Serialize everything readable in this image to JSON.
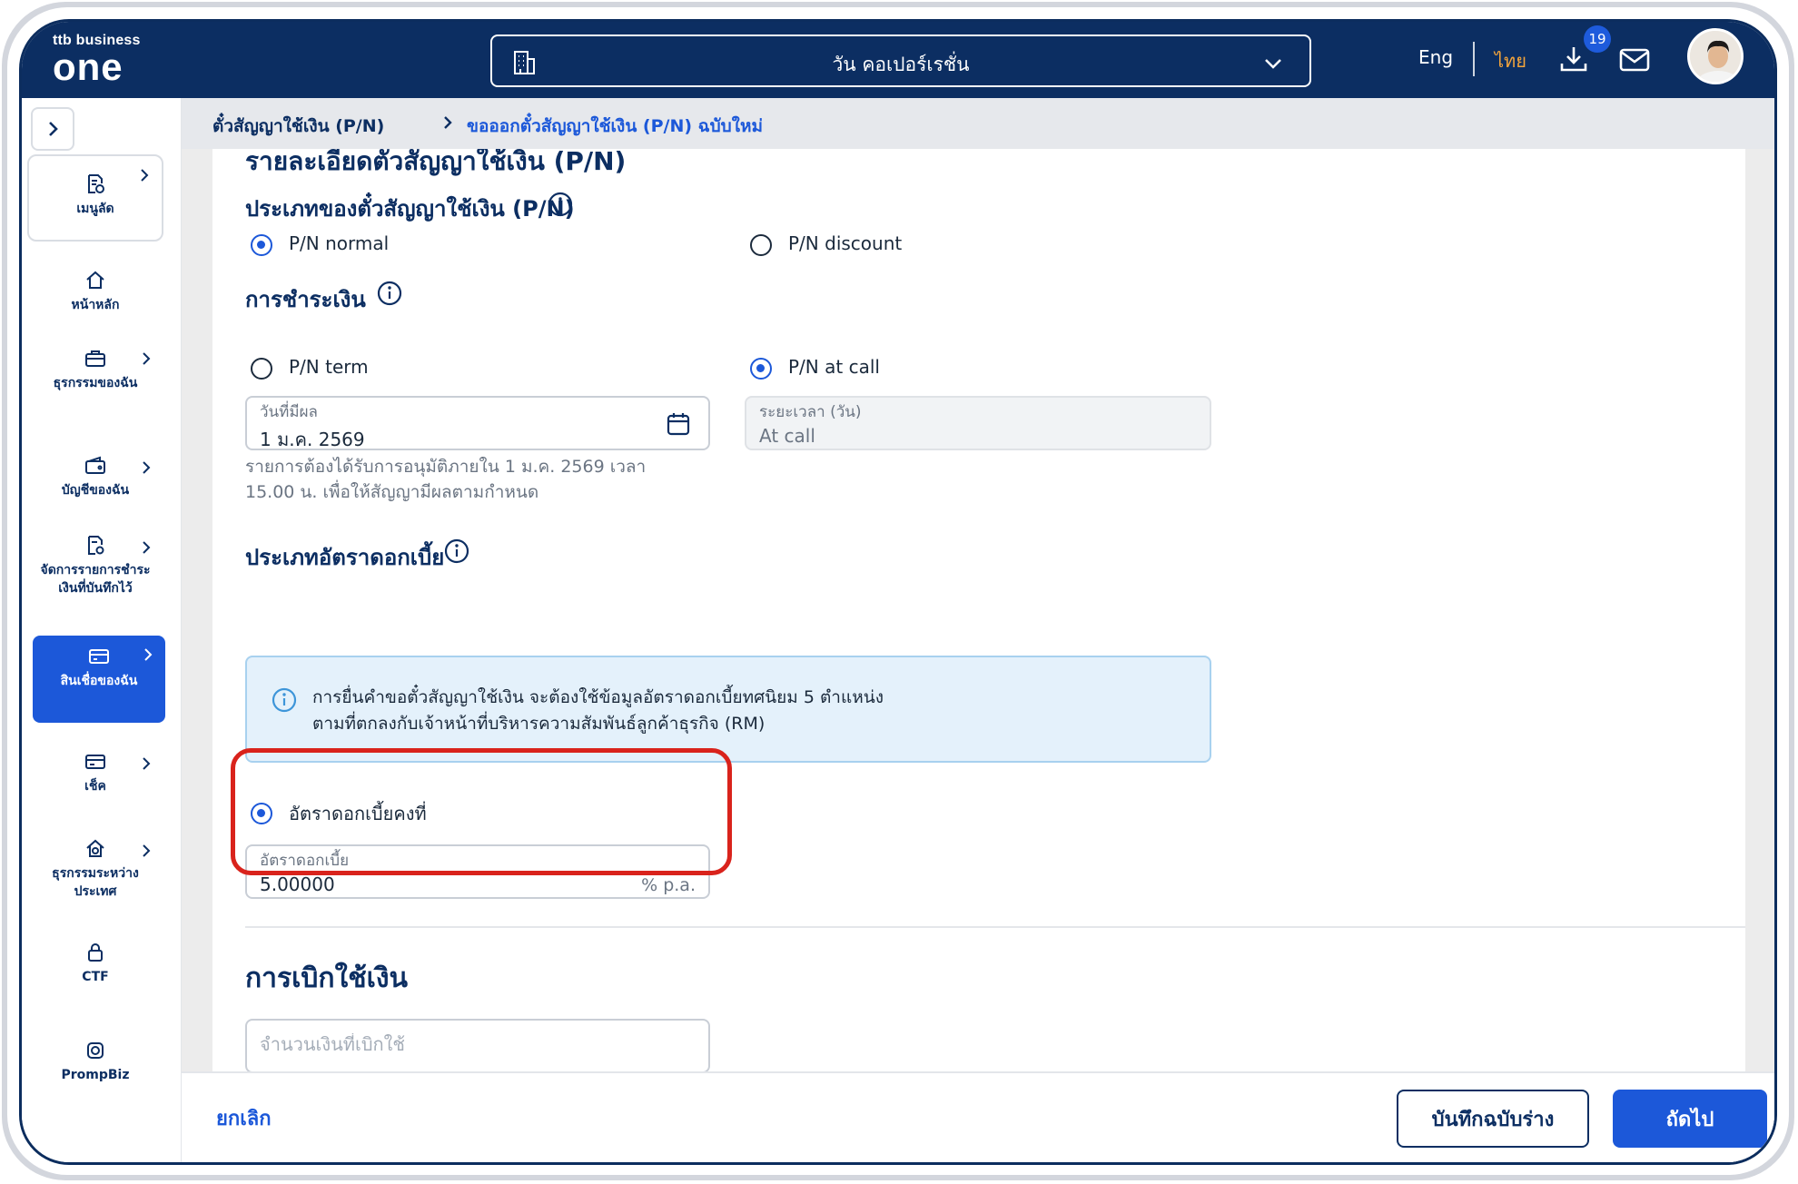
{
  "header": {
    "logo_small": "ttb business",
    "logo_big": "one",
    "company_name": "วัน คอเปอร์เรชั่น",
    "lang_eng": "Eng",
    "lang_th": "ไทย",
    "download_badge": "19"
  },
  "sidebar": {
    "items": [
      {
        "label": "เมนูลัด",
        "icon": "shortcut-doc-icon"
      },
      {
        "label": "หน้าหลัก",
        "icon": "home-icon"
      },
      {
        "label": "ธุรกรรมของฉัน",
        "icon": "briefcase-icon"
      },
      {
        "label": "บัญชีของฉัน",
        "icon": "wallet-icon"
      },
      {
        "label": "จัดการรายการชำระเงินที่บันทึกไว้",
        "icon": "doc-gear-icon"
      },
      {
        "label": "สินเชื่อของฉัน",
        "icon": "card-icon"
      },
      {
        "label": "เช็ค",
        "icon": "cheque-icon"
      },
      {
        "label": "ธุรกรรมระหว่างประเทศ",
        "icon": "global-home-icon"
      },
      {
        "label": "CTF",
        "icon": "lock-icon"
      },
      {
        "label": "PrompBiz",
        "icon": "prompbiz-icon"
      }
    ]
  },
  "breadcrumb": {
    "level1": "ตั๋วสัญญาใช้เงิน (P/N)",
    "level2": "ขอออกตั๋วสัญญาใช้เงิน (P/N) ฉบับใหม่"
  },
  "form": {
    "section_title": "รายละเอียดตั๋วสัญญาใช้เงิน (P/N)",
    "pn_type_label": "ประเภทของตั๋วสัญญาใช้เงิน (P/N)",
    "pn_type_options": [
      "P/N normal",
      "P/N discount"
    ],
    "pn_type_selected": "P/N normal",
    "payment_label": "การชำระเงิน",
    "payment_options": [
      "P/N term",
      "P/N at call"
    ],
    "payment_selected": "P/N at call",
    "effective_date_label": "วันที่มีผล",
    "effective_date_value": "1 ม.ค. 2569",
    "period_label": "ระยะเวลา (วัน)",
    "period_value": "At call",
    "help_line1": "รายการต้องได้รับการอนุมัติภายใน 1 ม.ค. 2569 เวลา",
    "help_line2": "15.00 น. เพื่อให้สัญญามีผลตามกำหนด",
    "interest_type_label": "ประเภทอัตราดอกเบี้ย",
    "notice_line1": "การยื่นคำขอตั๋วสัญญาใช้เงิน จะต้องใช้ข้อมูลอัตราดอกเบี้ยทศนิยม 5 ตำแหน่ง",
    "notice_line2": "ตามที่ตกลงกับเจ้าหน้าที่บริหารความสัมพันธ์ลูกค้าธุรกิจ (RM)",
    "fixed_rate_option": "อัตราดอกเบี้ยคงที่",
    "rate_label": "อัตราดอกเบี้ย",
    "rate_value": "5.00000",
    "rate_suffix": "% p.a.",
    "drawdown_title": "การเบิกใช้เงิน",
    "drawdown_placeholder": "จำนวนเงินที่เบิกใช้"
  },
  "footer": {
    "cancel": "ยกเลิก",
    "save_draft": "บันทึกฉบับร่าง",
    "next": "ถัดไป"
  },
  "colors": {
    "navy": "#0c2e62",
    "accent_blue": "#1c58d9",
    "orange": "#f3a43b",
    "highlight_red": "#d9231c"
  }
}
